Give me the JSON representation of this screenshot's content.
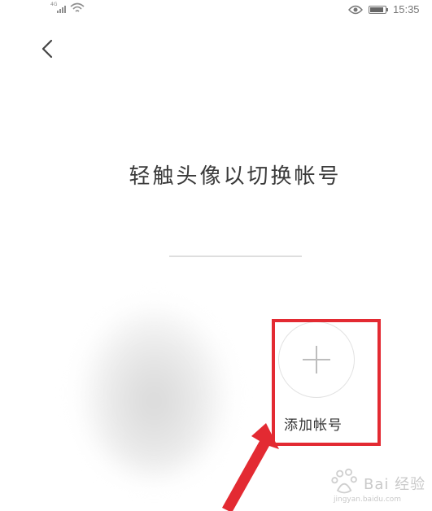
{
  "status_bar": {
    "network_type": "4G",
    "time": "15:35"
  },
  "header": {
    "back_icon": "chevron-left-icon"
  },
  "main": {
    "title": "轻触头像以切换帐号",
    "add_account_label": "添加帐号",
    "add_icon": "plus-icon"
  },
  "annotation": {
    "highlight_color": "#e32a32",
    "arrow_color": "#e32a32"
  },
  "watermark": {
    "text": "Bai 经验",
    "url": "jingyan.baidu.com"
  }
}
